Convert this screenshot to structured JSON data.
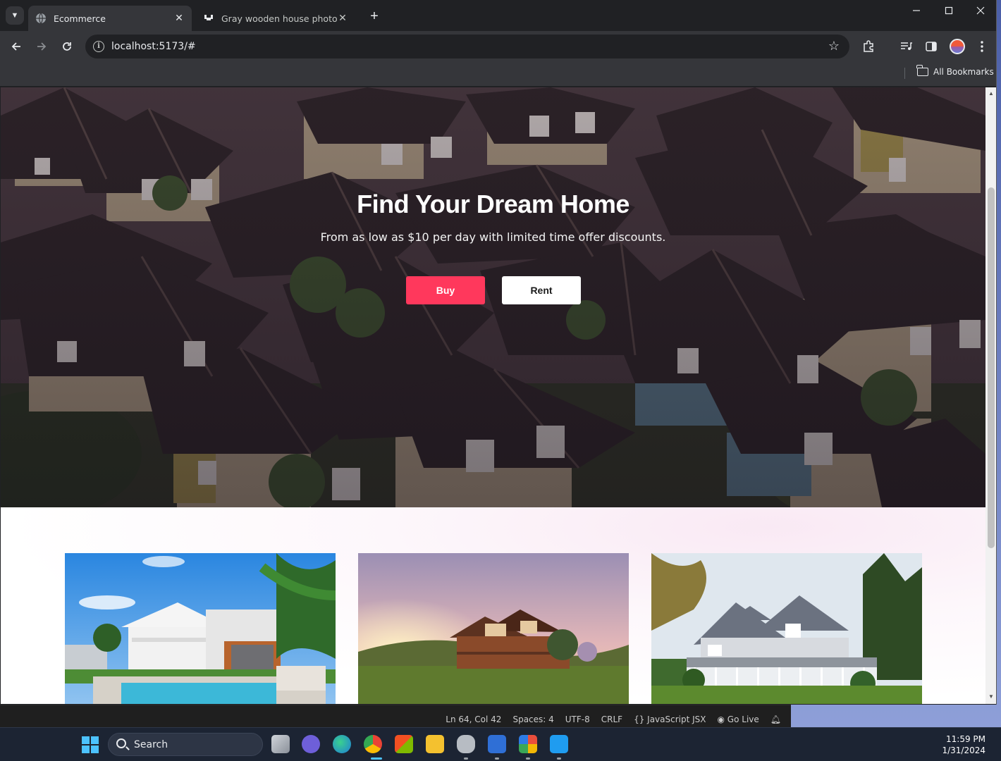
{
  "browser": {
    "tabs": [
      {
        "title": "Ecommerce",
        "active": true
      },
      {
        "title": "Gray wooden house photo – Fre",
        "active": false
      }
    ],
    "url": "localhost:5173/#",
    "bookmarks_label": "All Bookmarks",
    "window_controls": {
      "minimize": "—",
      "maximize": "☐",
      "close": "✕"
    }
  },
  "hero": {
    "title": "Find Your Dream Home",
    "subtitle": "From as low as $10 per day with limited time offer discounts.",
    "buy_label": "Buy",
    "rent_label": "Rent"
  },
  "colors": {
    "accent": "#ff385c",
    "browser_bg": "#202124",
    "toolbar_bg": "#35363a",
    "taskbar_bg": "#1c2433"
  },
  "listings": [
    {
      "icon": "house-pool-photo"
    },
    {
      "icon": "log-cabin-sunset-photo"
    },
    {
      "icon": "gray-wooden-house-photo"
    }
  ],
  "vscode_status": {
    "position": "Ln 64, Col 42",
    "spaces": "Spaces: 4",
    "encoding": "UTF-8",
    "eol": "CRLF",
    "language": "JavaScript JSX",
    "go_live": "Go Live"
  },
  "taskbar": {
    "search_label": "Search",
    "time": "11:59 PM",
    "date": "1/31/2024"
  }
}
